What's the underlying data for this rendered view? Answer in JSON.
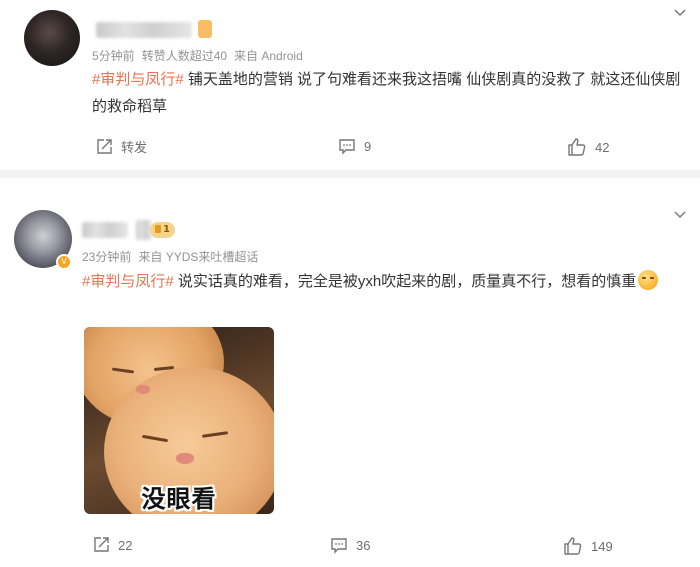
{
  "post1": {
    "meta_time": "5分钟前",
    "meta_reposts": "转赞人数超过40",
    "meta_source": "来自 Android",
    "hashtag": "#审判与凤行#",
    "text": " 铺天盖地的营销 说了句难看还来我这捂嘴 仙侠剧真的没救了 就这还仙侠剧的救命稻草",
    "repost_label": "转发",
    "comment_count": "9",
    "like_count": "42"
  },
  "post2": {
    "level_badge": "1",
    "meta_time": "23分钟前",
    "meta_source": "来自 YYDS来吐槽超话",
    "hashtag": "#审判与凤行#",
    "text": " 说实话真的难看，完全是被yxh吹起来的剧，质量真不行，想看的慎重",
    "image_caption": "没眼看",
    "repost_count": "22",
    "comment_count": "36",
    "like_count": "149"
  },
  "icons": {
    "dropdown": "chevron-down-icon",
    "repost": "repost-icon",
    "comment": "comment-icon",
    "like": "thumbs-up-icon",
    "verified": "verified-badge-icon",
    "emoji": "smirk-emoji-icon"
  },
  "colors": {
    "hashtag": "#eb7350",
    "meta": "#939393",
    "divider": "#f2f2f2"
  }
}
